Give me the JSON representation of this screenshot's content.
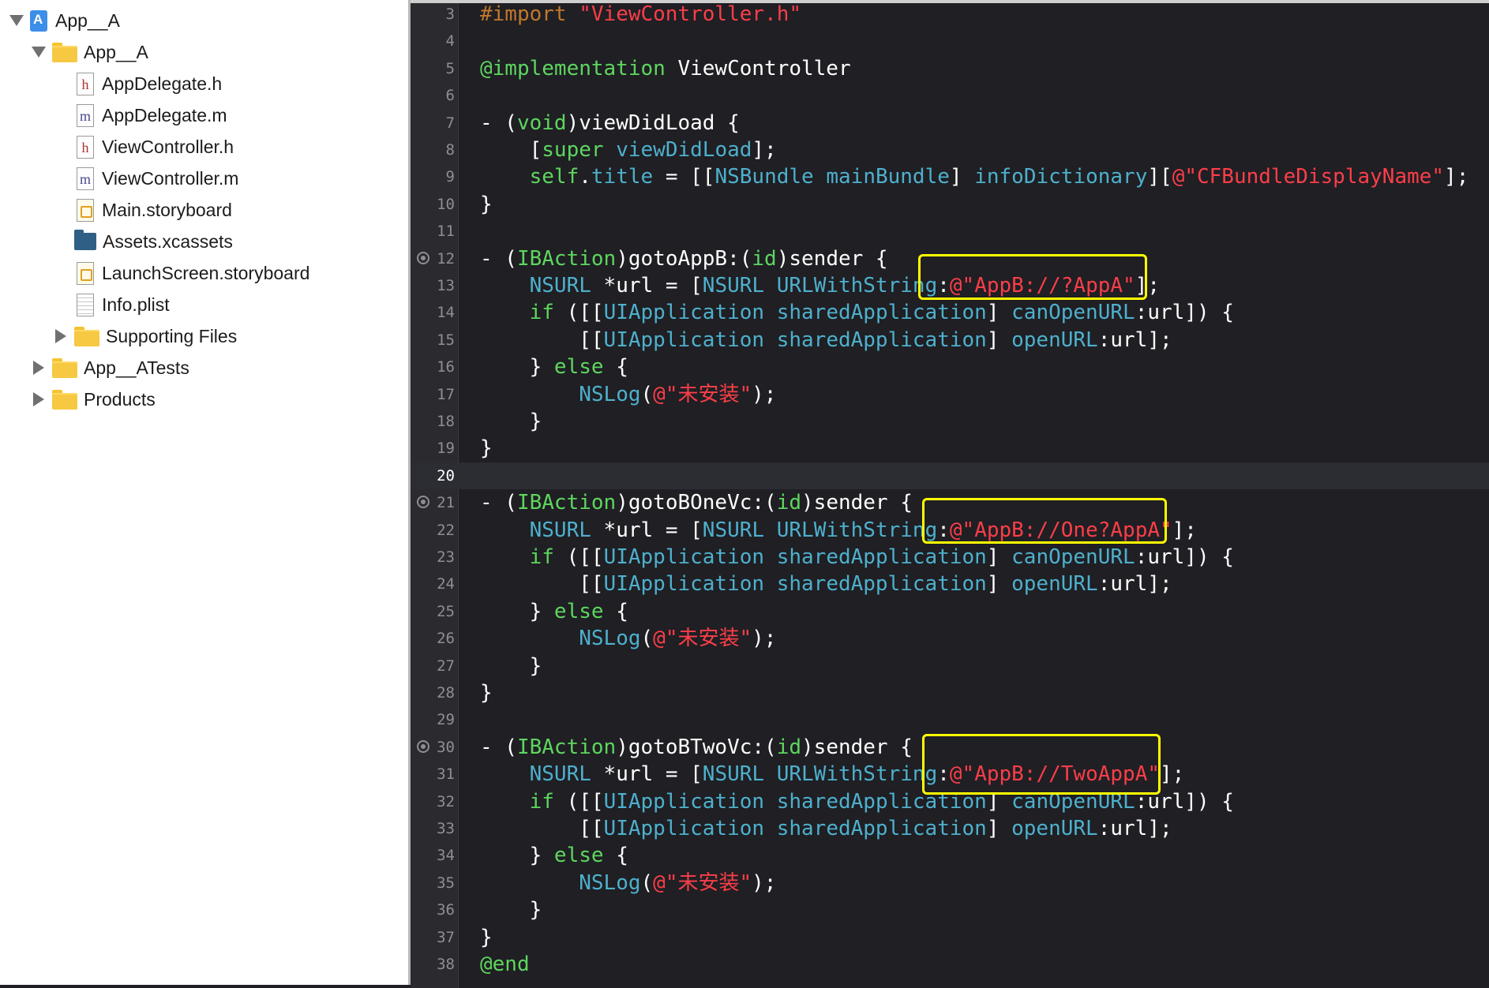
{
  "navigator": {
    "items": [
      {
        "label": "App__A",
        "icon": "xcode-project-icon",
        "kind": "project",
        "indent": 0,
        "disclosure": "open"
      },
      {
        "label": "App__A",
        "icon": "folder-icon",
        "kind": "folder",
        "indent": 1,
        "disclosure": "open"
      },
      {
        "label": "AppDelegate.h",
        "icon": "header-file-icon",
        "kind": "h",
        "indent": 2,
        "disclosure": "none"
      },
      {
        "label": "AppDelegate.m",
        "icon": "implementation-file-icon",
        "kind": "m",
        "indent": 2,
        "disclosure": "none"
      },
      {
        "label": "ViewController.h",
        "icon": "header-file-icon",
        "kind": "h",
        "indent": 2,
        "disclosure": "none"
      },
      {
        "label": "ViewController.m",
        "icon": "implementation-file-icon",
        "kind": "m",
        "indent": 2,
        "disclosure": "none"
      },
      {
        "label": "Main.storyboard",
        "icon": "storyboard-icon",
        "kind": "storyboard",
        "indent": 2,
        "disclosure": "none"
      },
      {
        "label": "Assets.xcassets",
        "icon": "assets-folder-icon",
        "kind": "assets",
        "indent": 2,
        "disclosure": "none"
      },
      {
        "label": "LaunchScreen.storyboard",
        "icon": "storyboard-icon",
        "kind": "storyboard",
        "indent": 2,
        "disclosure": "none"
      },
      {
        "label": "Info.plist",
        "icon": "plist-icon",
        "kind": "plist",
        "indent": 2,
        "disclosure": "none"
      },
      {
        "label": "Supporting Files",
        "icon": "folder-icon",
        "kind": "folder",
        "indent": 2,
        "disclosure": "closed"
      },
      {
        "label": "App__ATests",
        "icon": "folder-icon",
        "kind": "folder",
        "indent": 1,
        "disclosure": "closed"
      },
      {
        "label": "Products",
        "icon": "folder-icon",
        "kind": "folder",
        "indent": 1,
        "disclosure": "closed"
      }
    ]
  },
  "editor": {
    "current_line": 20,
    "colors": {
      "keyword": "#5ed65e",
      "type": "#4eb0cc",
      "preprocessor": "#c0782c",
      "string": "#fb3e48",
      "plain": "#ffffff",
      "highlight_box": "#ffff00"
    },
    "lines": [
      {
        "num": "3",
        "tokens": [
          [
            "pre",
            "#import "
          ],
          [
            "str",
            "\"ViewController.h\""
          ]
        ]
      },
      {
        "num": "4",
        "tokens": []
      },
      {
        "num": "5",
        "tokens": [
          [
            "kw",
            "@implementation"
          ],
          [
            "plain",
            " ViewController"
          ]
        ]
      },
      {
        "num": "6",
        "tokens": []
      },
      {
        "num": "7",
        "tokens": [
          [
            "plain",
            "- ("
          ],
          [
            "kw",
            "void"
          ],
          [
            "plain",
            ")viewDidLoad {"
          ]
        ]
      },
      {
        "num": "8",
        "tokens": [
          [
            "plain",
            "    ["
          ],
          [
            "kw",
            "super"
          ],
          [
            "plain",
            " "
          ],
          [
            "type",
            "viewDidLoad"
          ],
          [
            "plain",
            "];"
          ]
        ]
      },
      {
        "num": "9",
        "tokens": [
          [
            "plain",
            "    "
          ],
          [
            "kw",
            "self"
          ],
          [
            "plain",
            "."
          ],
          [
            "type",
            "title"
          ],
          [
            "plain",
            " = [["
          ],
          [
            "type",
            "NSBundle"
          ],
          [
            "plain",
            " "
          ],
          [
            "type",
            "mainBundle"
          ],
          [
            "plain",
            "] "
          ],
          [
            "type",
            "infoDictionary"
          ],
          [
            "plain",
            "]["
          ],
          [
            "str",
            "@\"CFBundleDisplayName\""
          ],
          [
            "plain",
            "];"
          ]
        ]
      },
      {
        "num": "10",
        "tokens": [
          [
            "plain",
            "}"
          ]
        ]
      },
      {
        "num": "11",
        "tokens": []
      },
      {
        "num": "12",
        "bp": true,
        "tokens": [
          [
            "plain",
            "- ("
          ],
          [
            "kw",
            "IBAction"
          ],
          [
            "plain",
            ")gotoAppB:("
          ],
          [
            "kw",
            "id"
          ],
          [
            "plain",
            ")sender {"
          ]
        ]
      },
      {
        "num": "13",
        "tokens": [
          [
            "plain",
            "    "
          ],
          [
            "type",
            "NSURL"
          ],
          [
            "plain",
            " *url = ["
          ],
          [
            "type",
            "NSURL"
          ],
          [
            "plain",
            " "
          ],
          [
            "type",
            "URLWithString"
          ],
          [
            "plain",
            ":"
          ],
          [
            "str",
            "@\"AppB://?AppA\""
          ],
          [
            "plain",
            "];"
          ]
        ]
      },
      {
        "num": "14",
        "tokens": [
          [
            "plain",
            "    "
          ],
          [
            "kw",
            "if"
          ],
          [
            "plain",
            " ([["
          ],
          [
            "type",
            "UIApplication"
          ],
          [
            "plain",
            " "
          ],
          [
            "type",
            "sharedApplication"
          ],
          [
            "plain",
            "] "
          ],
          [
            "type",
            "canOpenURL"
          ],
          [
            "plain",
            ":url]) {"
          ]
        ]
      },
      {
        "num": "15",
        "tokens": [
          [
            "plain",
            "        [["
          ],
          [
            "type",
            "UIApplication"
          ],
          [
            "plain",
            " "
          ],
          [
            "type",
            "sharedApplication"
          ],
          [
            "plain",
            "] "
          ],
          [
            "type",
            "openURL"
          ],
          [
            "plain",
            ":url];"
          ]
        ]
      },
      {
        "num": "16",
        "tokens": [
          [
            "plain",
            "    } "
          ],
          [
            "kw",
            "else"
          ],
          [
            "plain",
            " {"
          ]
        ]
      },
      {
        "num": "17",
        "tokens": [
          [
            "plain",
            "        "
          ],
          [
            "type",
            "NSLog"
          ],
          [
            "plain",
            "("
          ],
          [
            "str",
            "@\"未安装\""
          ],
          [
            "plain",
            ");"
          ]
        ]
      },
      {
        "num": "18",
        "tokens": [
          [
            "plain",
            "    }"
          ]
        ]
      },
      {
        "num": "19",
        "tokens": [
          [
            "plain",
            "}"
          ]
        ]
      },
      {
        "num": "20",
        "tokens": []
      },
      {
        "num": "21",
        "bp": true,
        "tokens": [
          [
            "plain",
            "- ("
          ],
          [
            "kw",
            "IBAction"
          ],
          [
            "plain",
            ")gotoBOneVc:("
          ],
          [
            "kw",
            "id"
          ],
          [
            "plain",
            ")sender {"
          ]
        ]
      },
      {
        "num": "22",
        "tokens": [
          [
            "plain",
            "    "
          ],
          [
            "type",
            "NSURL"
          ],
          [
            "plain",
            " *url = ["
          ],
          [
            "type",
            "NSURL"
          ],
          [
            "plain",
            " "
          ],
          [
            "type",
            "URLWithString"
          ],
          [
            "plain",
            ":"
          ],
          [
            "str",
            "@\"AppB://One?AppA\""
          ],
          [
            "plain",
            "];"
          ]
        ]
      },
      {
        "num": "23",
        "tokens": [
          [
            "plain",
            "    "
          ],
          [
            "kw",
            "if"
          ],
          [
            "plain",
            " ([["
          ],
          [
            "type",
            "UIApplication"
          ],
          [
            "plain",
            " "
          ],
          [
            "type",
            "sharedApplication"
          ],
          [
            "plain",
            "] "
          ],
          [
            "type",
            "canOpenURL"
          ],
          [
            "plain",
            ":url]) {"
          ]
        ]
      },
      {
        "num": "24",
        "tokens": [
          [
            "plain",
            "        [["
          ],
          [
            "type",
            "UIApplication"
          ],
          [
            "plain",
            " "
          ],
          [
            "type",
            "sharedApplication"
          ],
          [
            "plain",
            "] "
          ],
          [
            "type",
            "openURL"
          ],
          [
            "plain",
            ":url];"
          ]
        ]
      },
      {
        "num": "25",
        "tokens": [
          [
            "plain",
            "    } "
          ],
          [
            "kw",
            "else"
          ],
          [
            "plain",
            " {"
          ]
        ]
      },
      {
        "num": "26",
        "tokens": [
          [
            "plain",
            "        "
          ],
          [
            "type",
            "NSLog"
          ],
          [
            "plain",
            "("
          ],
          [
            "str",
            "@\"未安装\""
          ],
          [
            "plain",
            ");"
          ]
        ]
      },
      {
        "num": "27",
        "tokens": [
          [
            "plain",
            "    }"
          ]
        ]
      },
      {
        "num": "28",
        "tokens": [
          [
            "plain",
            "}"
          ]
        ]
      },
      {
        "num": "29",
        "tokens": []
      },
      {
        "num": "30",
        "bp": true,
        "tokens": [
          [
            "plain",
            "- ("
          ],
          [
            "kw",
            "IBAction"
          ],
          [
            "plain",
            ")gotoBTwoVc:("
          ],
          [
            "kw",
            "id"
          ],
          [
            "plain",
            ")sender {"
          ]
        ]
      },
      {
        "num": "31",
        "tokens": [
          [
            "plain",
            "    "
          ],
          [
            "type",
            "NSURL"
          ],
          [
            "plain",
            " *url = ["
          ],
          [
            "type",
            "NSURL"
          ],
          [
            "plain",
            " "
          ],
          [
            "type",
            "URLWithString"
          ],
          [
            "plain",
            ":"
          ],
          [
            "str",
            "@\"AppB://TwoAppA\""
          ],
          [
            "plain",
            "];"
          ]
        ]
      },
      {
        "num": "32",
        "tokens": [
          [
            "plain",
            "    "
          ],
          [
            "kw",
            "if"
          ],
          [
            "plain",
            " ([["
          ],
          [
            "type",
            "UIApplication"
          ],
          [
            "plain",
            " "
          ],
          [
            "type",
            "sharedApplication"
          ],
          [
            "plain",
            "] "
          ],
          [
            "type",
            "canOpenURL"
          ],
          [
            "plain",
            ":url]) {"
          ]
        ]
      },
      {
        "num": "33",
        "tokens": [
          [
            "plain",
            "        [["
          ],
          [
            "type",
            "UIApplication"
          ],
          [
            "plain",
            " "
          ],
          [
            "type",
            "sharedApplication"
          ],
          [
            "plain",
            "] "
          ],
          [
            "type",
            "openURL"
          ],
          [
            "plain",
            ":url];"
          ]
        ]
      },
      {
        "num": "34",
        "tokens": [
          [
            "plain",
            "    } "
          ],
          [
            "kw",
            "else"
          ],
          [
            "plain",
            " {"
          ]
        ]
      },
      {
        "num": "35",
        "tokens": [
          [
            "plain",
            "        "
          ],
          [
            "type",
            "NSLog"
          ],
          [
            "plain",
            "("
          ],
          [
            "str",
            "@\"未安装\""
          ],
          [
            "plain",
            ");"
          ]
        ]
      },
      {
        "num": "36",
        "tokens": [
          [
            "plain",
            "    }"
          ]
        ]
      },
      {
        "num": "37",
        "tokens": [
          [
            "plain",
            "}"
          ]
        ]
      },
      {
        "num": "38",
        "tokens": [
          [
            "kw",
            "@end"
          ]
        ]
      }
    ]
  }
}
